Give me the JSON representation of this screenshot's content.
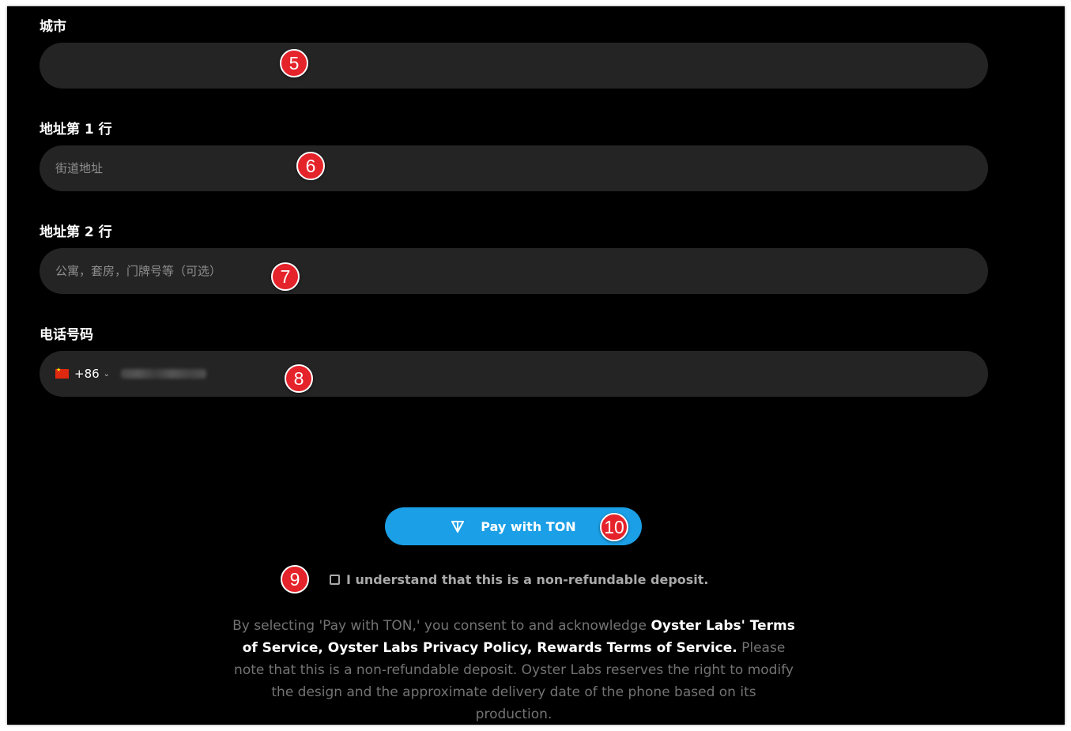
{
  "form": {
    "city": {
      "label": "城市",
      "value": "",
      "placeholder": ""
    },
    "address1": {
      "label": "地址第 1 行",
      "placeholder": "街道地址"
    },
    "address2": {
      "label": "地址第 2 行",
      "placeholder": "公寓，套房，门牌号等（可选）"
    },
    "phone": {
      "label": "电话号码",
      "country_code": "+86",
      "country_flag": "china-flag-icon"
    }
  },
  "pay_button": {
    "label": "Pay with TON",
    "icon": "ton-logo-icon",
    "color": "#1b9fe6"
  },
  "consent": {
    "label": "I understand that this is a non-refundable deposit.",
    "checked": false
  },
  "legal": {
    "lead": "By selecting 'Pay with TON,' you consent to and acknowledge ",
    "link1": "Oyster Labs' Terms of Service",
    "sep1": ", ",
    "link2": "Oyster Labs Privacy Policy",
    "sep2": ", ",
    "link3": "Rewards Terms of Service.",
    "note": " Please note that this is a non-refundable deposit. Oyster Labs reserves the right to modify the design and the approximate delivery date of the phone based on its production."
  },
  "annotations": [
    "5",
    "6",
    "7",
    "8",
    "9",
    "10"
  ],
  "colors": {
    "background": "#000000",
    "field": "#242424",
    "badge": "#e5232a"
  }
}
